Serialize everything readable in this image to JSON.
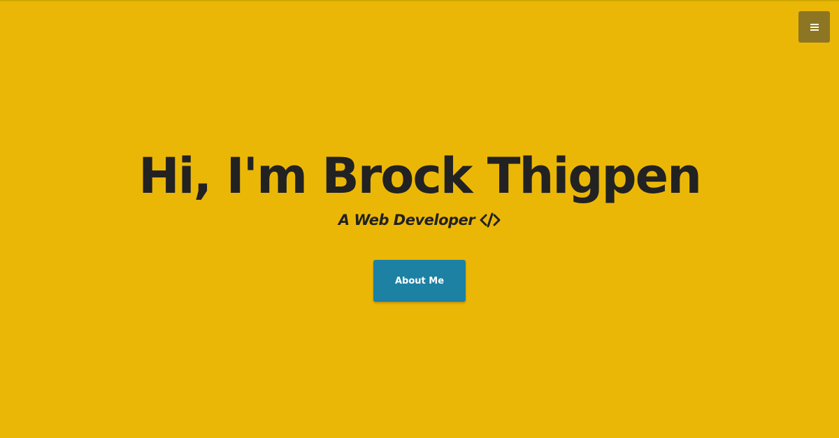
{
  "colors": {
    "background": "#ebb707",
    "text": "#222222",
    "menu_button": "#8d7623",
    "cta_button": "#1d81a3",
    "cta_text": "#ffffff"
  },
  "header": {
    "menu_icon": "hamburger-menu-icon"
  },
  "hero": {
    "title": "Hi, I'm Brock Thigpen",
    "subtitle": "A Web Developer",
    "subtitle_icon": "code-icon",
    "cta_label": "About Me"
  }
}
